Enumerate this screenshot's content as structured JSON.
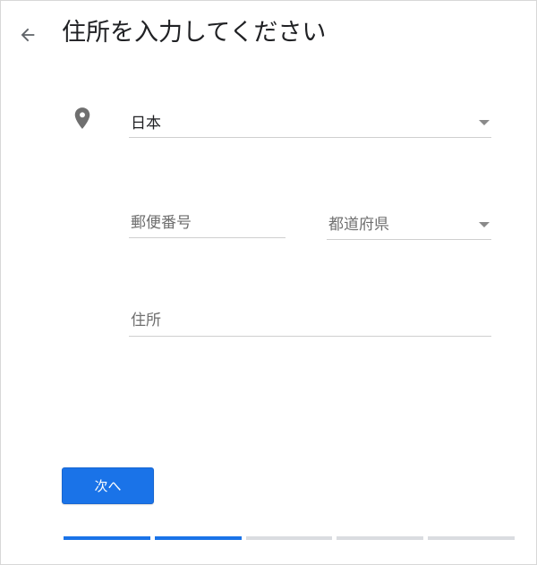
{
  "header": {
    "title": "住所を入力してください",
    "back_icon": "arrow-left-icon"
  },
  "form": {
    "location_icon": "map-pin-icon",
    "country": {
      "value": "日本",
      "icon": "dropdown-caret-icon"
    },
    "postal_code": {
      "placeholder": "郵便番号",
      "value": ""
    },
    "prefecture": {
      "placeholder": "都道府県",
      "icon": "dropdown-caret-icon"
    },
    "address": {
      "placeholder": "住所",
      "value": ""
    }
  },
  "actions": {
    "next_label": "次へ"
  },
  "progress": {
    "total_steps": 5,
    "completed_steps": 2
  },
  "colors": {
    "accent": "#1a73e8",
    "inactive": "#dadce0",
    "divider": "#cfcfcf"
  }
}
